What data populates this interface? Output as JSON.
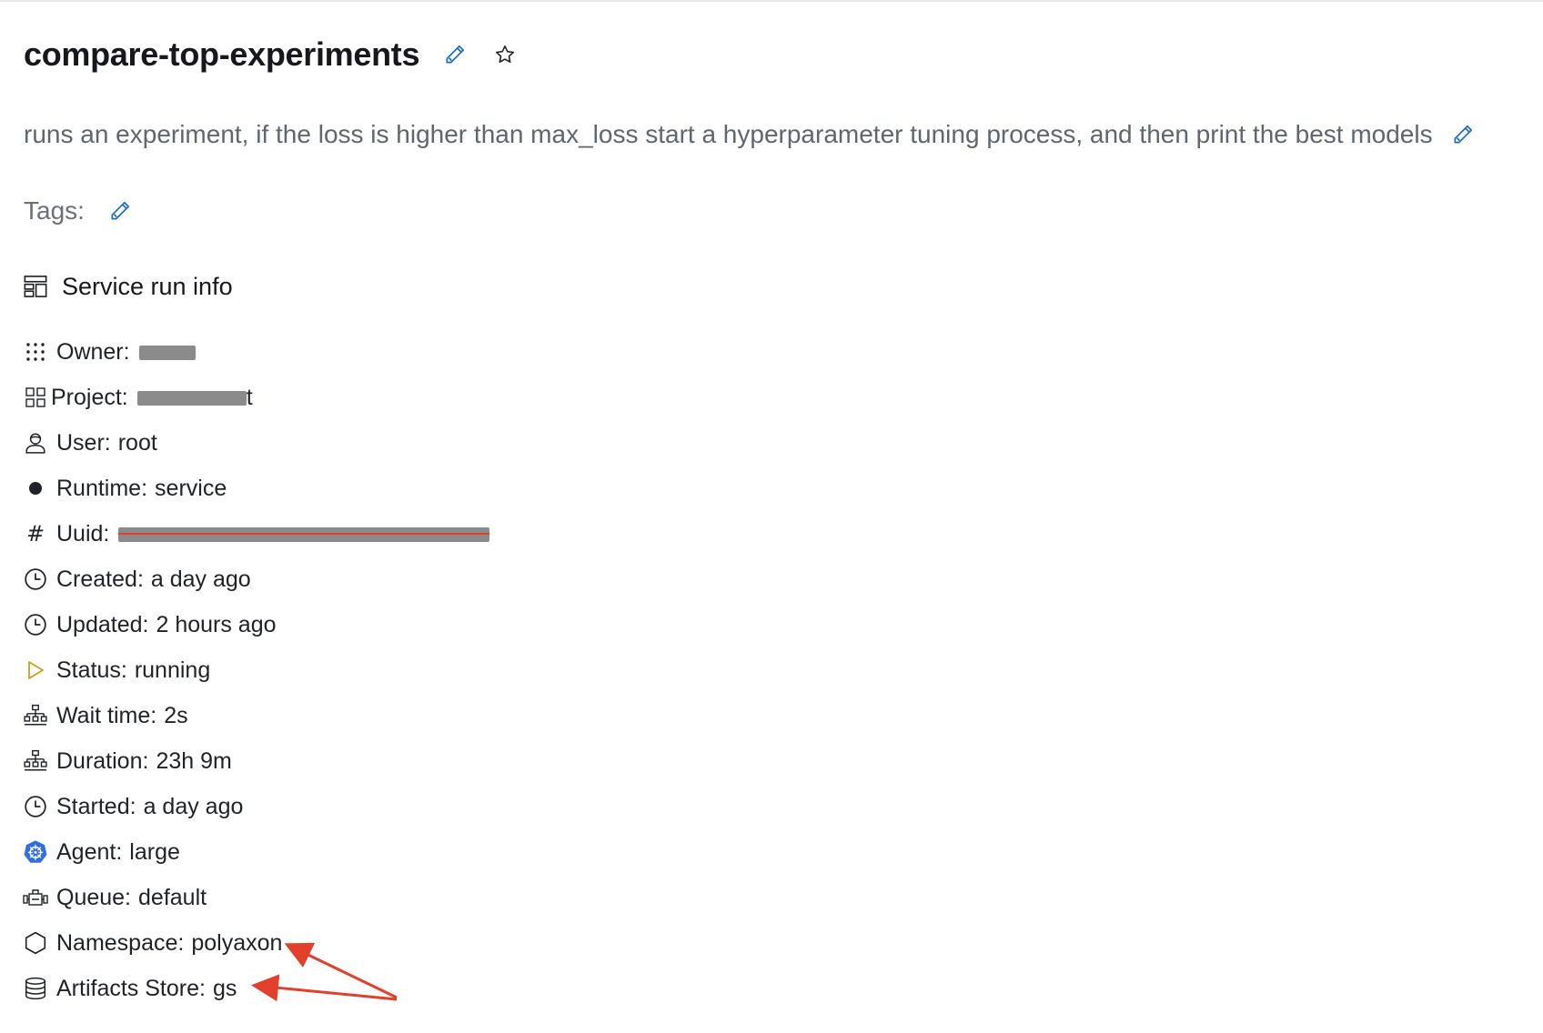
{
  "header": {
    "title": "compare-top-experiments",
    "description": "runs an experiment, if the loss is higher than max_loss start a hyperparameter tuning process, and then print the best models",
    "tags_label": "Tags:"
  },
  "section": {
    "title": "Service run info"
  },
  "info": {
    "owner": {
      "label": "Owner:"
    },
    "project": {
      "label": "Project:",
      "visible_tail": "t"
    },
    "user": {
      "label": "User:",
      "value": "root"
    },
    "runtime": {
      "label": "Runtime:",
      "value": "service"
    },
    "uuid": {
      "label": "Uuid:"
    },
    "created": {
      "label": "Created:",
      "value": "a day ago"
    },
    "updated": {
      "label": "Updated:",
      "value": "2 hours ago"
    },
    "status": {
      "label": "Status:",
      "value": "running"
    },
    "wait_time": {
      "label": "Wait time:",
      "value": "2s"
    },
    "duration": {
      "label": "Duration:",
      "value": "23h 9m"
    },
    "started": {
      "label": "Started:",
      "value": "a day ago"
    },
    "agent": {
      "label": "Agent:",
      "value": "large"
    },
    "queue": {
      "label": "Queue:",
      "value": "default"
    },
    "namespace": {
      "label": "Namespace:",
      "value": "polyaxon"
    },
    "artifacts_store": {
      "label": "Artifacts Store:",
      "value": "gs"
    }
  },
  "icons": {
    "title_edit": "pencil-icon",
    "star": "star-icon",
    "desc_edit": "pencil-icon",
    "tags_edit": "pencil-icon",
    "section": "layout-icon",
    "owner": "dots-grid-icon",
    "project": "project-grid-icon",
    "user": "user-icon",
    "runtime": "dot-icon",
    "uuid": "hash-icon",
    "created": "clock-icon",
    "updated": "clock-icon",
    "status": "play-icon",
    "wait_time": "sitemap-icon",
    "duration": "sitemap-icon",
    "started": "clock-icon",
    "agent": "kubernetes-icon",
    "queue": "queue-icon",
    "namespace": "hexagon-icon",
    "artifacts_store": "database-icon"
  },
  "colors": {
    "accent": "#1f6fbf",
    "text": "#1f2328",
    "muted": "#5f6670",
    "status_running": "#c9a21a",
    "kubernetes": "#326ce5",
    "annotation_arrow": "#e2402a",
    "redaction": "#8b8b8b"
  }
}
